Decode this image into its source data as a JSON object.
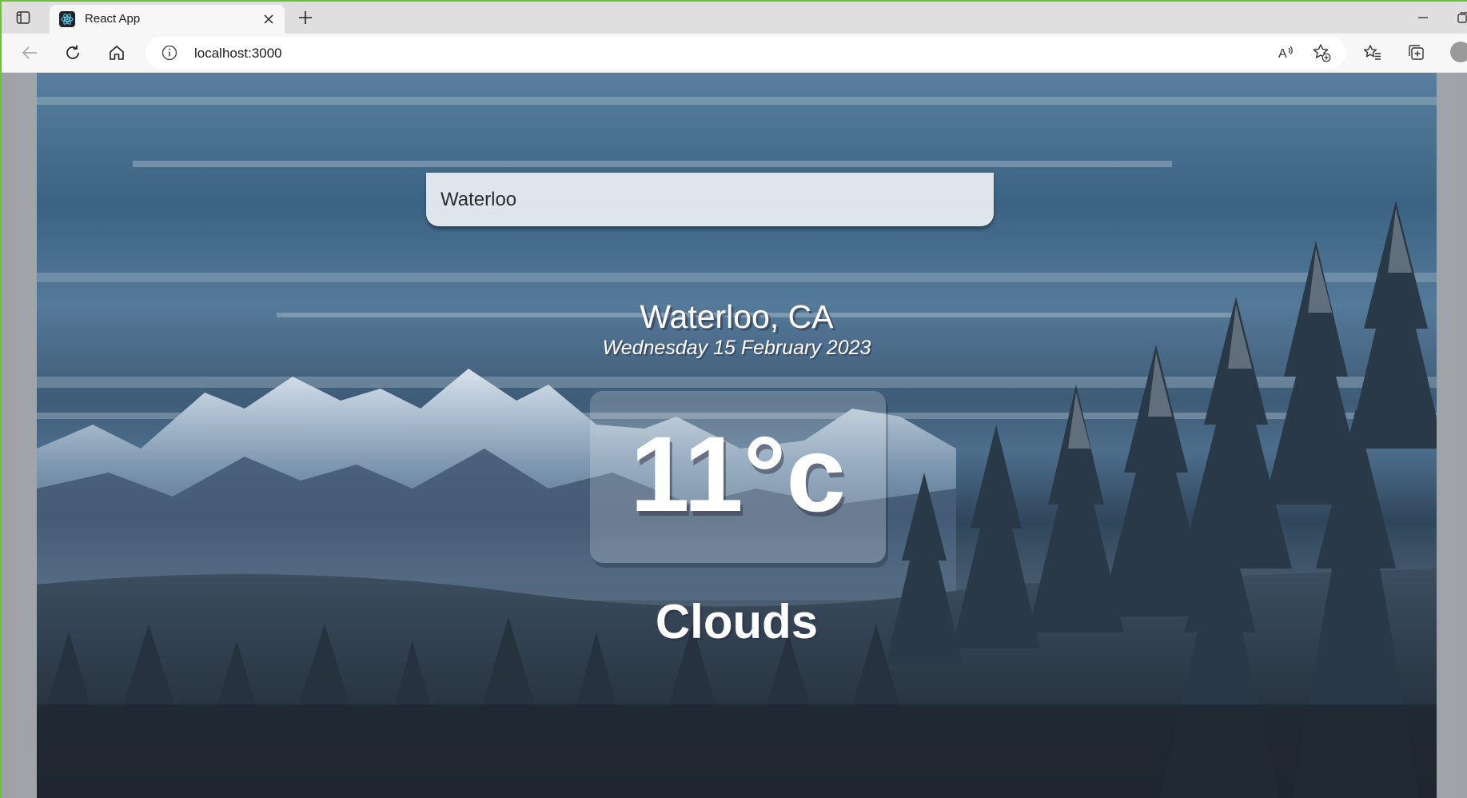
{
  "browser": {
    "tab": {
      "title": "React App",
      "favicon": "react-logo-icon"
    },
    "address": {
      "url": "localhost:3000"
    },
    "icons": {
      "tab_actions": "tab-actions-icon",
      "close": "close-icon",
      "new_tab": "plus-icon",
      "back": "back-arrow-icon",
      "refresh": "refresh-icon",
      "home": "home-icon",
      "info": "info-icon",
      "read_aloud": "read-aloud-icon",
      "add_favorite": "add-favorite-icon",
      "favorites": "favorites-icon",
      "collections": "collections-icon",
      "minimize": "minimize-icon",
      "restore": "restore-icon"
    }
  },
  "app": {
    "search": {
      "value": "Waterloo"
    },
    "location": "Waterloo, CA",
    "date": "Wednesday 15 February 2023",
    "temperature": "11°c",
    "weather": "Clouds"
  },
  "colors": {
    "accent_border": "#6fbf3a",
    "text_white": "#ffffff"
  }
}
